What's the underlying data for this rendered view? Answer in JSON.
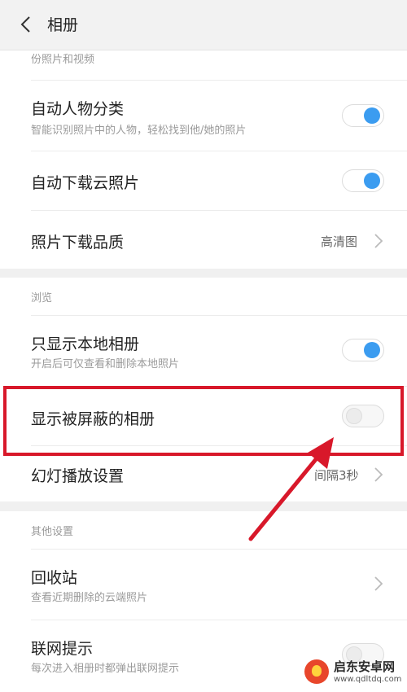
{
  "header": {
    "title": "相册",
    "back_icon": "chevron-left-icon"
  },
  "sections": {
    "backup": {
      "header_partial": "份照片和视频"
    },
    "browse": {
      "header": "浏览"
    },
    "other": {
      "header": "其他设置"
    }
  },
  "settings": {
    "auto_face": {
      "title": "自动人物分类",
      "subtitle": "智能识别照片中的人物，轻松找到他/她的照片",
      "enabled": true
    },
    "auto_download": {
      "title": "自动下载云照片",
      "enabled": true
    },
    "download_quality": {
      "title": "照片下载品质",
      "value": "高清图"
    },
    "local_only": {
      "title": "只显示本地相册",
      "subtitle": "开启后可仅查看和删除本地照片",
      "enabled": true
    },
    "show_hidden": {
      "title": "显示被屏蔽的相册",
      "enabled": false
    },
    "slideshow": {
      "title": "幻灯播放设置",
      "value": "间隔3秒"
    },
    "recycle_bin": {
      "title": "回收站",
      "subtitle": "查看近期删除的云端照片"
    },
    "network_prompt": {
      "title": "联网提示",
      "subtitle": "每次进入相册时都弹出联网提示",
      "enabled": false
    }
  },
  "watermark": {
    "name": "启东安卓网",
    "url": "www.qdltdq.com"
  },
  "colors": {
    "accent": "#3b9cf0",
    "highlight": "#d8182a",
    "background": "#f0f0f0"
  }
}
